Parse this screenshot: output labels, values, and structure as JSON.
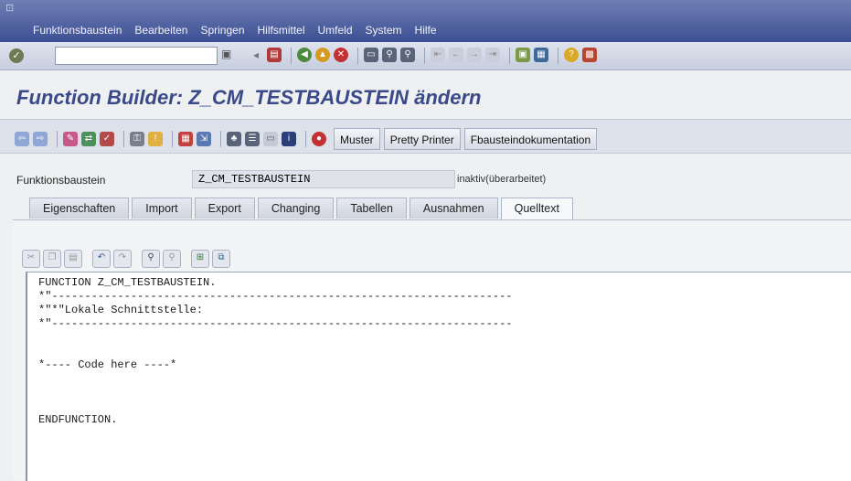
{
  "menubar": {
    "items": [
      "Funktionsbaustein",
      "Bearbeiten",
      "Springen",
      "Hilfsmittel",
      "Umfeld",
      "System",
      "Hilfe"
    ]
  },
  "standard_toolbar": {
    "command_field_value": "",
    "icons": [
      "enter-icon",
      "save-icon",
      "back-icon",
      "exit-icon",
      "cancel-icon",
      "print-icon",
      "find-icon",
      "find-next-icon",
      "first-page-icon",
      "previous-page-icon",
      "next-page-icon",
      "last-page-icon",
      "new-session-icon",
      "shortcut-icon",
      "help-icon",
      "layout-icon"
    ]
  },
  "title": "Function Builder: Z_CM_TESTBAUSTEIN ändern",
  "app_toolbar": {
    "icons": [
      "back-arrow-icon",
      "forward-arrow-icon",
      "display-change-icon",
      "active-inactive-icon",
      "check-icon",
      "activate-icon",
      "test-icon",
      "where-used-icon",
      "object-list-icon",
      "navigation-icon",
      "hierarchy-icon",
      "info-icon",
      "stop-icon"
    ],
    "buttons": [
      "Muster",
      "Pretty Printer",
      "Fbausteindokumentation"
    ]
  },
  "header": {
    "label": "Funktionsbaustein",
    "value": "Z_CM_TESTBAUSTEIN",
    "status": "inaktiv(überarbeitet)"
  },
  "tabs": [
    {
      "label": "Eigenschaften",
      "active": false
    },
    {
      "label": "Import",
      "active": false
    },
    {
      "label": "Export",
      "active": false
    },
    {
      "label": "Changing",
      "active": false
    },
    {
      "label": "Tabellen",
      "active": false
    },
    {
      "label": "Ausnahmen",
      "active": false
    },
    {
      "label": "Quelltext",
      "active": true
    }
  ],
  "editor_toolbar": {
    "icons": [
      "cut-icon",
      "copy-icon",
      "paste-icon",
      "undo-icon",
      "redo-icon",
      "find-icon",
      "find-next-icon",
      "insert-icon",
      "replace-icon"
    ]
  },
  "code": [
    "FUNCTION Z_CM_TESTBAUSTEIN.",
    "*\"----------------------------------------------------------------------",
    "*\"*\"Lokale Schnittstelle:",
    "*\"----------------------------------------------------------------------",
    "",
    "",
    "*---- Code here ----*",
    "",
    "",
    "",
    "ENDFUNCTION."
  ],
  "colors": {
    "menubar": "#3d4f93",
    "title": "#3a4a88"
  }
}
